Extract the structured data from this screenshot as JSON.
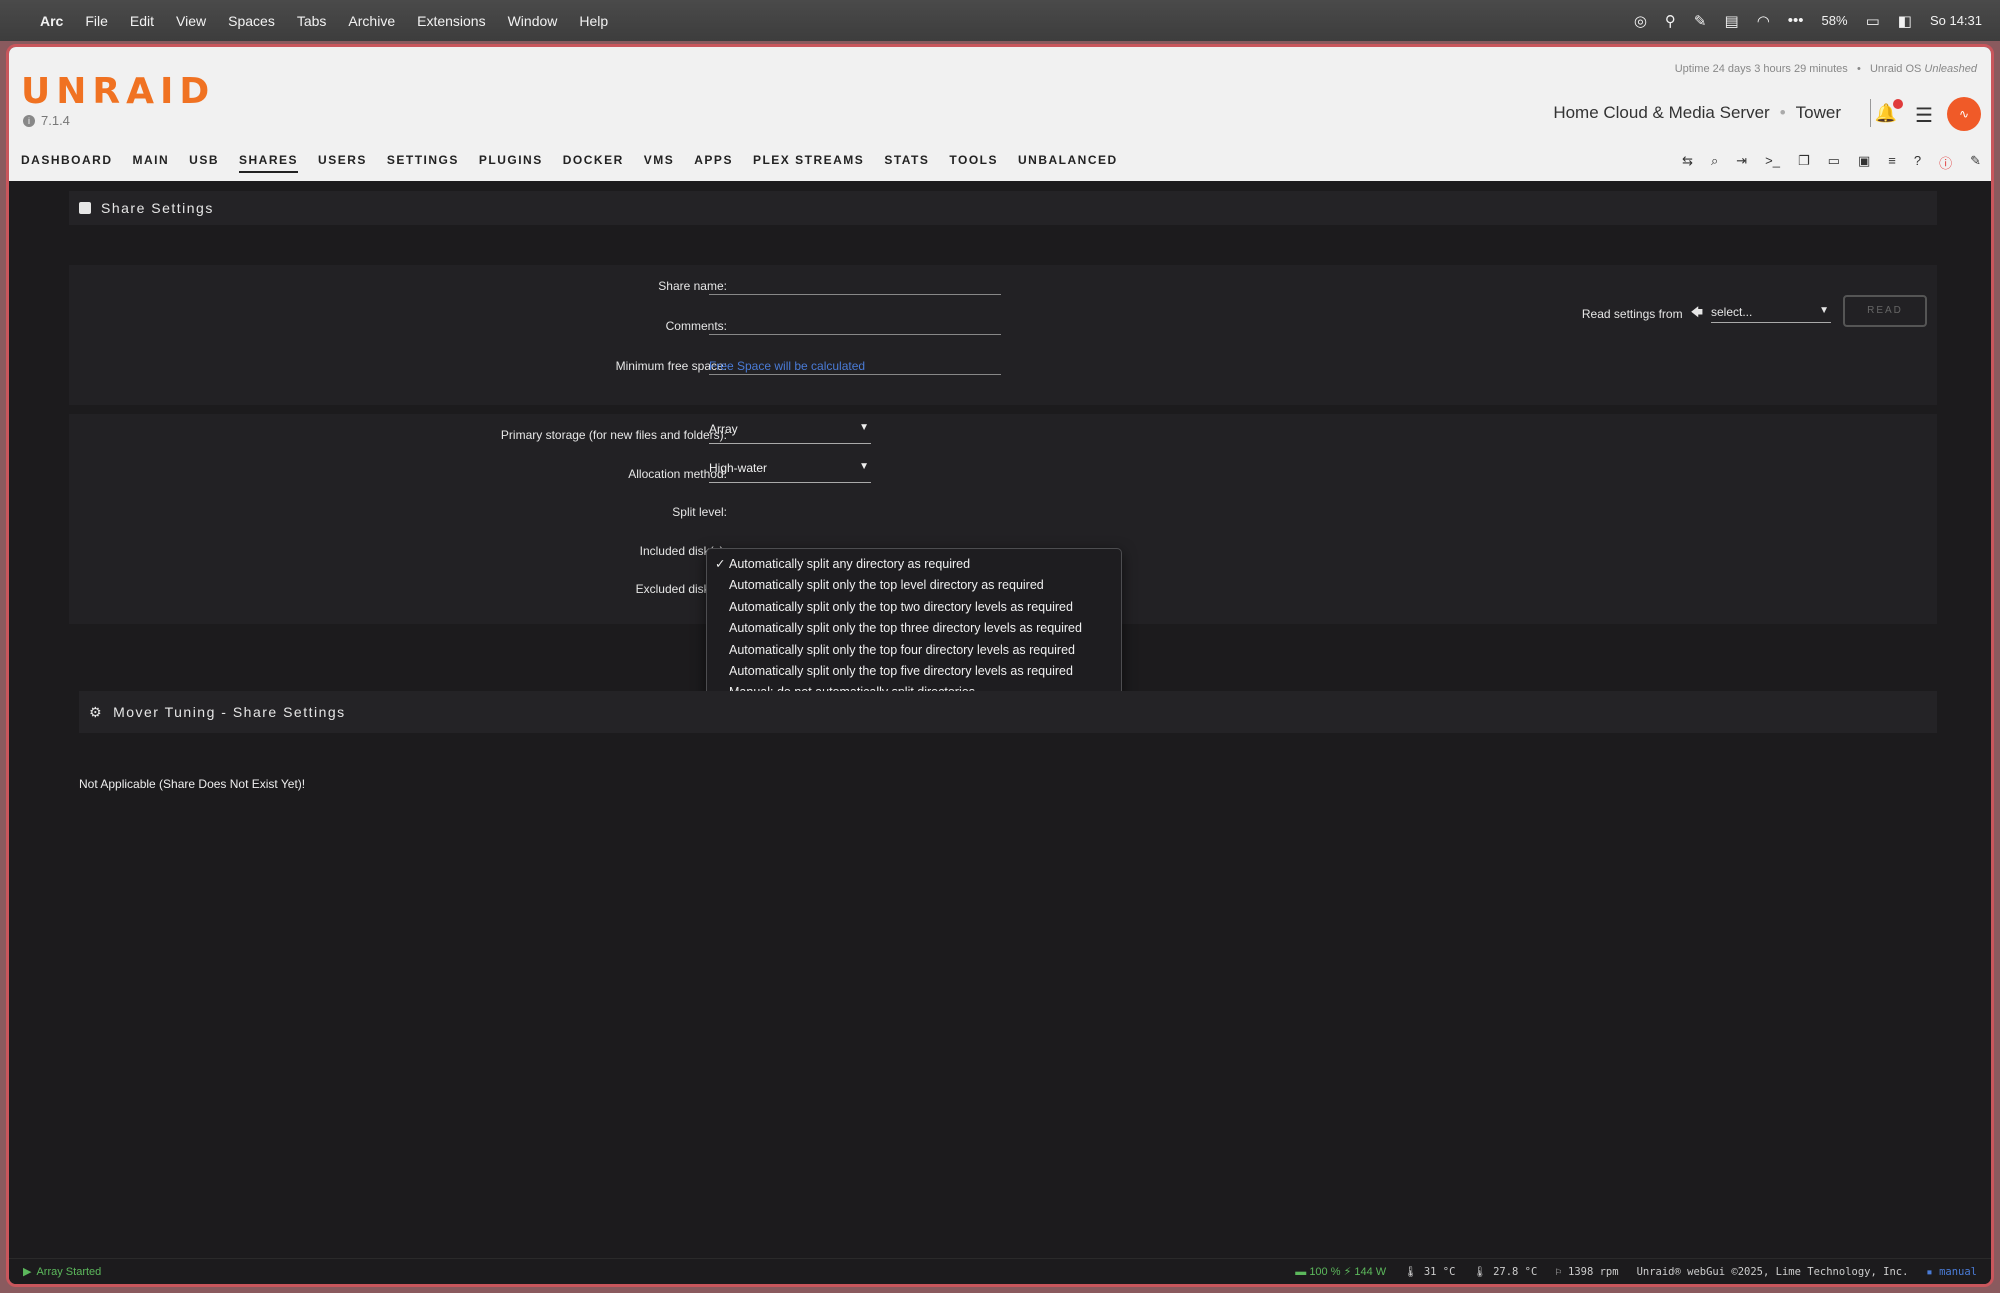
{
  "menubar": {
    "app": "Arc",
    "items": [
      "File",
      "Edit",
      "View",
      "Spaces",
      "Tabs",
      "Archive",
      "Extensions",
      "Window",
      "Help"
    ],
    "battery": "58%",
    "clock": "So 14:31"
  },
  "header": {
    "logo": "UNRAID",
    "version": "7.1.4",
    "uptime": "Uptime 24 days 3 hours 29 minutes",
    "os_prefix": "Unraid OS",
    "os_edition": "Unleashed",
    "server_description": "Home Cloud & Media Server",
    "server_name": "Tower"
  },
  "nav": {
    "tabs": [
      "DASHBOARD",
      "MAIN",
      "USB",
      "SHARES",
      "USERS",
      "SETTINGS",
      "PLUGINS",
      "DOCKER",
      "VMS",
      "APPS",
      "PLEX STREAMS",
      "STATS",
      "TOOLS",
      "UNBALANCED"
    ],
    "active": "SHARES"
  },
  "share_settings": {
    "title": "Share Settings",
    "share_name_label": "Share name:",
    "share_name_value": "",
    "comments_label": "Comments:",
    "comments_value": "",
    "min_free_label": "Minimum free space:",
    "min_free_placeholder": "Free Space will be calculated",
    "read_settings_label": "Read settings from",
    "read_settings_select": "select...",
    "read_button": "READ",
    "primary_storage_label": "Primary storage (for new files and folders):",
    "primary_storage_value": "Array",
    "allocation_label": "Allocation method:",
    "allocation_value": "High-water",
    "split_level_label": "Split level:",
    "included_label": "Included disk(s):",
    "excluded_label": "Excluded disk(s):"
  },
  "split_dropdown": {
    "selected_index": 0,
    "options": [
      "Automatically split any directory as required",
      "Automatically split only the top level directory as required",
      "Automatically split only the top two directory levels as required",
      "Automatically split only the top three directory levels as required",
      "Automatically split only the top four directory levels as required",
      "Automatically split only the top five directory levels as required",
      "Manual: do not automatically split directories"
    ]
  },
  "mover": {
    "title": "Mover Tuning - Share Settings",
    "note": "Not Applicable (Share Does Not Exist Yet)!"
  },
  "footer": {
    "status": "Array Started",
    "ups_percent": "100 %",
    "power": "144 W",
    "temp1": "31 °C",
    "temp2": "27.8 °C",
    "fan": "1398 rpm",
    "copyright": "Unraid® webGui ©2025, Lime Technology, Inc.",
    "manual": "manual"
  },
  "colors": {
    "accent": "#f07222",
    "link_blue": "#4a7bd6",
    "status_green": "#5cb85c"
  }
}
